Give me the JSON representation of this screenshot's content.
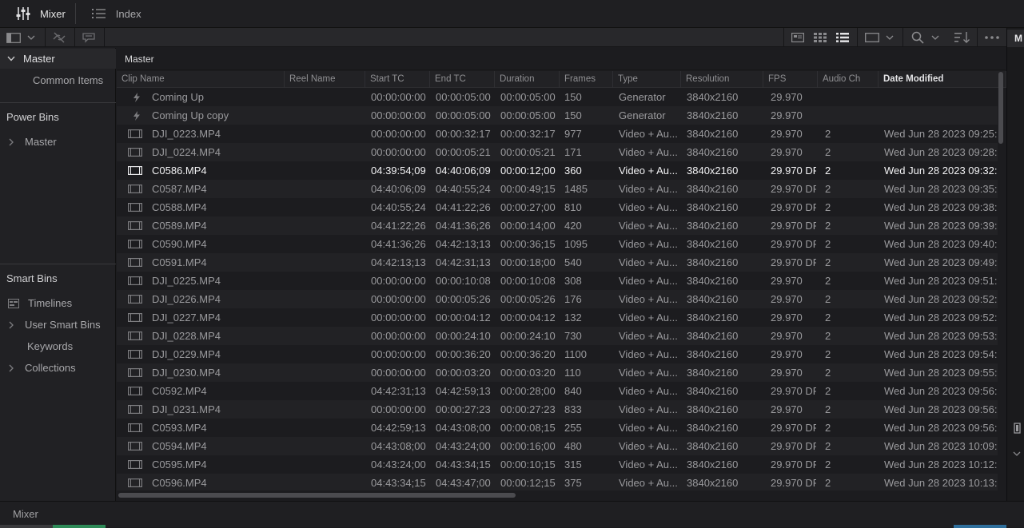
{
  "topbar": {
    "tabs": [
      {
        "label": "Mixer",
        "icon": "mixer-sliders-icon",
        "active": true
      },
      {
        "label": "Index",
        "icon": "list-icon",
        "active": false
      }
    ]
  },
  "breadcrumb": "Master",
  "sidebar": {
    "master": {
      "label": "Master",
      "child": "Common Items"
    },
    "power_bins": {
      "header": "Power Bins",
      "items": [
        {
          "label": "Master",
          "expandable": true
        }
      ]
    },
    "smart_bins": {
      "header": "Smart Bins",
      "items": [
        {
          "label": "Timelines",
          "icon": "timeline-bin-icon",
          "expandable": false
        },
        {
          "label": "User Smart Bins",
          "expandable": true
        },
        {
          "label": "Keywords",
          "expandable": false
        },
        {
          "label": "Collections",
          "expandable": true
        }
      ]
    }
  },
  "right_panel": {
    "tab_label": "M"
  },
  "bottom": {
    "page_label": "Mixer"
  },
  "table": {
    "columns": [
      "Clip Name",
      "Reel Name",
      "Start TC",
      "End TC",
      "Duration",
      "Frames",
      "Type",
      "Resolution",
      "FPS",
      "Audio Ch",
      "Date Modified"
    ],
    "sorted_column": "Date Modified",
    "selected_row": 4,
    "rows": [
      {
        "icon": "generator-icon",
        "name": "Coming Up",
        "reel": "",
        "start": "00:00:00:00",
        "end": "00:00:05:00",
        "duration": "00:00:05:00",
        "frames": "150",
        "type": "Generator",
        "res": "3840x2160",
        "fps": "29.970",
        "audio": "",
        "date": ""
      },
      {
        "icon": "generator-icon",
        "name": "Coming Up copy",
        "reel": "",
        "start": "00:00:00:00",
        "end": "00:00:05:00",
        "duration": "00:00:05:00",
        "frames": "150",
        "type": "Generator",
        "res": "3840x2160",
        "fps": "29.970",
        "audio": "",
        "date": ""
      },
      {
        "icon": "film-clip-icon",
        "name": "DJI_0223.MP4",
        "reel": "",
        "start": "00:00:00:00",
        "end": "00:00:32:17",
        "duration": "00:00:32:17",
        "frames": "977",
        "type": "Video + Au...",
        "res": "3840x2160",
        "fps": "29.970",
        "audio": "2",
        "date": "Wed Jun 28 2023 09:25:"
      },
      {
        "icon": "film-clip-icon",
        "name": "DJI_0224.MP4",
        "reel": "",
        "start": "00:00:00:00",
        "end": "00:00:05:21",
        "duration": "00:00:05:21",
        "frames": "171",
        "type": "Video + Au...",
        "res": "3840x2160",
        "fps": "29.970",
        "audio": "2",
        "date": "Wed Jun 28 2023 09:28:"
      },
      {
        "icon": "film-clip-icon",
        "name": "C0586.MP4",
        "reel": "",
        "start": "04:39:54;09",
        "end": "04:40:06;09",
        "duration": "00:00:12;00",
        "frames": "360",
        "type": "Video + Au...",
        "res": "3840x2160",
        "fps": "29.970 DF",
        "audio": "2",
        "date": "Wed Jun 28 2023 09:32:"
      },
      {
        "icon": "film-clip-icon",
        "name": "C0587.MP4",
        "reel": "",
        "start": "04:40:06;09",
        "end": "04:40:55;24",
        "duration": "00:00:49;15",
        "frames": "1485",
        "type": "Video + Au...",
        "res": "3840x2160",
        "fps": "29.970 DF",
        "audio": "2",
        "date": "Wed Jun 28 2023 09:35:"
      },
      {
        "icon": "film-clip-icon",
        "name": "C0588.MP4",
        "reel": "",
        "start": "04:40:55;24",
        "end": "04:41:22;26",
        "duration": "00:00:27;00",
        "frames": "810",
        "type": "Video + Au...",
        "res": "3840x2160",
        "fps": "29.970 DF",
        "audio": "2",
        "date": "Wed Jun 28 2023 09:38:"
      },
      {
        "icon": "film-clip-icon",
        "name": "C0589.MP4",
        "reel": "",
        "start": "04:41:22;26",
        "end": "04:41:36;26",
        "duration": "00:00:14;00",
        "frames": "420",
        "type": "Video + Au...",
        "res": "3840x2160",
        "fps": "29.970 DF",
        "audio": "2",
        "date": "Wed Jun 28 2023 09:39:"
      },
      {
        "icon": "film-clip-icon",
        "name": "C0590.MP4",
        "reel": "",
        "start": "04:41:36;26",
        "end": "04:42:13;13",
        "duration": "00:00:36;15",
        "frames": "1095",
        "type": "Video + Au...",
        "res": "3840x2160",
        "fps": "29.970 DF",
        "audio": "2",
        "date": "Wed Jun 28 2023 09:40:"
      },
      {
        "icon": "film-clip-icon",
        "name": "C0591.MP4",
        "reel": "",
        "start": "04:42:13;13",
        "end": "04:42:31;13",
        "duration": "00:00:18;00",
        "frames": "540",
        "type": "Video + Au...",
        "res": "3840x2160",
        "fps": "29.970 DF",
        "audio": "2",
        "date": "Wed Jun 28 2023 09:49:"
      },
      {
        "icon": "film-clip-icon",
        "name": "DJI_0225.MP4",
        "reel": "",
        "start": "00:00:00:00",
        "end": "00:00:10:08",
        "duration": "00:00:10:08",
        "frames": "308",
        "type": "Video + Au...",
        "res": "3840x2160",
        "fps": "29.970",
        "audio": "2",
        "date": "Wed Jun 28 2023 09:51:"
      },
      {
        "icon": "film-clip-icon",
        "name": "DJI_0226.MP4",
        "reel": "",
        "start": "00:00:00:00",
        "end": "00:00:05:26",
        "duration": "00:00:05:26",
        "frames": "176",
        "type": "Video + Au...",
        "res": "3840x2160",
        "fps": "29.970",
        "audio": "2",
        "date": "Wed Jun 28 2023 09:52:"
      },
      {
        "icon": "film-clip-icon",
        "name": "DJI_0227.MP4",
        "reel": "",
        "start": "00:00:00:00",
        "end": "00:00:04:12",
        "duration": "00:00:04:12",
        "frames": "132",
        "type": "Video + Au...",
        "res": "3840x2160",
        "fps": "29.970",
        "audio": "2",
        "date": "Wed Jun 28 2023 09:52:"
      },
      {
        "icon": "film-clip-icon",
        "name": "DJI_0228.MP4",
        "reel": "",
        "start": "00:00:00:00",
        "end": "00:00:24:10",
        "duration": "00:00:24:10",
        "frames": "730",
        "type": "Video + Au...",
        "res": "3840x2160",
        "fps": "29.970",
        "audio": "2",
        "date": "Wed Jun 28 2023 09:53:"
      },
      {
        "icon": "film-clip-icon",
        "name": "DJI_0229.MP4",
        "reel": "",
        "start": "00:00:00:00",
        "end": "00:00:36:20",
        "duration": "00:00:36:20",
        "frames": "1100",
        "type": "Video + Au...",
        "res": "3840x2160",
        "fps": "29.970",
        "audio": "2",
        "date": "Wed Jun 28 2023 09:54:"
      },
      {
        "icon": "film-clip-icon",
        "name": "DJI_0230.MP4",
        "reel": "",
        "start": "00:00:00:00",
        "end": "00:00:03:20",
        "duration": "00:00:03:20",
        "frames": "110",
        "type": "Video + Au...",
        "res": "3840x2160",
        "fps": "29.970",
        "audio": "2",
        "date": "Wed Jun 28 2023 09:55:"
      },
      {
        "icon": "film-clip-icon",
        "name": "C0592.MP4",
        "reel": "",
        "start": "04:42:31;13",
        "end": "04:42:59;13",
        "duration": "00:00:28;00",
        "frames": "840",
        "type": "Video + Au...",
        "res": "3840x2160",
        "fps": "29.970 DF",
        "audio": "2",
        "date": "Wed Jun 28 2023 09:56:"
      },
      {
        "icon": "film-clip-icon",
        "name": "DJI_0231.MP4",
        "reel": "",
        "start": "00:00:00:00",
        "end": "00:00:27:23",
        "duration": "00:00:27:23",
        "frames": "833",
        "type": "Video + Au...",
        "res": "3840x2160",
        "fps": "29.970",
        "audio": "2",
        "date": "Wed Jun 28 2023 09:56:"
      },
      {
        "icon": "film-clip-icon",
        "name": "C0593.MP4",
        "reel": "",
        "start": "04:42:59;13",
        "end": "04:43:08;00",
        "duration": "00:00:08;15",
        "frames": "255",
        "type": "Video + Au...",
        "res": "3840x2160",
        "fps": "29.970 DF",
        "audio": "2",
        "date": "Wed Jun 28 2023 09:56:"
      },
      {
        "icon": "film-clip-icon",
        "name": "C0594.MP4",
        "reel": "",
        "start": "04:43:08;00",
        "end": "04:43:24;00",
        "duration": "00:00:16;00",
        "frames": "480",
        "type": "Video + Au...",
        "res": "3840x2160",
        "fps": "29.970 DF",
        "audio": "2",
        "date": "Wed Jun 28 2023 10:09:"
      },
      {
        "icon": "film-clip-icon",
        "name": "C0595.MP4",
        "reel": "",
        "start": "04:43:24;00",
        "end": "04:43:34;15",
        "duration": "00:00:10;15",
        "frames": "315",
        "type": "Video + Au...",
        "res": "3840x2160",
        "fps": "29.970 DF",
        "audio": "2",
        "date": "Wed Jun 28 2023 10:12:"
      },
      {
        "icon": "film-clip-icon",
        "name": "C0596.MP4",
        "reel": "",
        "start": "04:43:34;15",
        "end": "04:43:47;00",
        "duration": "00:00:12;15",
        "frames": "375",
        "type": "Video + Au...",
        "res": "3840x2160",
        "fps": "29.970 DF",
        "audio": "2",
        "date": "Wed Jun 28 2023 10:13:"
      }
    ]
  }
}
